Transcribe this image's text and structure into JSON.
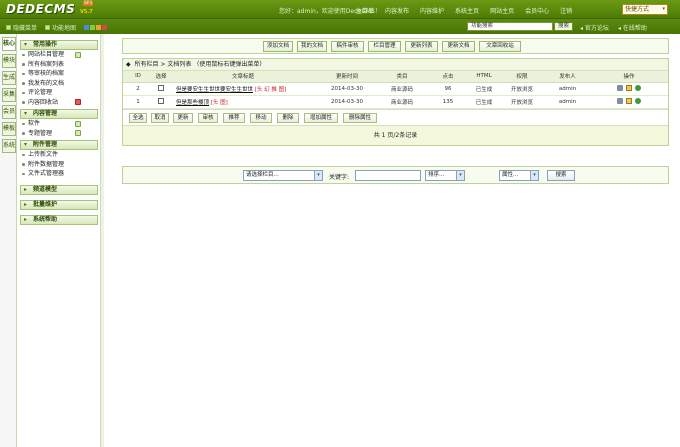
{
  "header": {
    "logo": "DEDECMS",
    "logo_badge": "SP1",
    "version": "V5.7",
    "welcome": "您好：admin，欢迎使用DedeCMS！",
    "nav": [
      "主菜单",
      "内容发布",
      "内容维护",
      "系统主页",
      "网站主页",
      "会员中心",
      "注销"
    ],
    "quick_menu": "快捷方式"
  },
  "subbar": {
    "hide_menu": "隐藏菜单",
    "sitemap": "功能地图",
    "skin_colors": [
      "#4a8fd3",
      "#8cc63f",
      "#f0a030",
      "#d04a4a"
    ],
    "search_placeholder": "功能搜索",
    "search_button": "搜索",
    "links": [
      "官方论坛",
      "在线帮助"
    ]
  },
  "vtabs": [
    "核心",
    "模块",
    "生成",
    "采集",
    "会员",
    "模板",
    "系统"
  ],
  "leftmenu": {
    "groups": [
      {
        "title": "常用操作",
        "items": [
          "网站栏目管理",
          "所有档案列表",
          "等审核的档案",
          "我发布的文档",
          "评论管理",
          "内容回收站"
        ]
      },
      {
        "title": "内容管理",
        "items": [
          "软件",
          "专题管理"
        ]
      },
      {
        "title": "附件管理",
        "items": [
          "上传新文件",
          "附件数据管理",
          "文件式管理器"
        ]
      },
      {
        "title": "频道模型",
        "items": []
      },
      {
        "title": "批量维护",
        "items": []
      },
      {
        "title": "系统帮助",
        "items": []
      }
    ]
  },
  "toolbar": [
    "添加文档",
    "我的文档",
    "稿件审核",
    "栏目管理",
    "更新列表",
    "更新文档",
    "文章回收站"
  ],
  "list": {
    "title": "所有栏目 > 文档列表",
    "hint": "（使用鼠标右键弹出菜单）",
    "columns": [
      "ID",
      "选择",
      "文章标题",
      "更新时间",
      "类目",
      "点击",
      "HTML",
      "权限",
      "发布人",
      "操作"
    ],
    "rows": [
      {
        "id": "2",
        "title": "但是要安生生世世要安生生世世",
        "tags": "[头 幻 推 图]",
        "date": "2014-03-30",
        "category": "商业源码",
        "clicks": "96",
        "html": "已生成",
        "perm": "开放浏览",
        "author": "admin"
      },
      {
        "id": "1",
        "title": "但是那些楼顶",
        "tags": "[头 图]",
        "date": "2014-03-30",
        "category": "商业源码",
        "clicks": "135",
        "html": "已生成",
        "perm": "开放浏览",
        "author": "admin"
      }
    ],
    "bulk_buttons": [
      "全选",
      "取消",
      "更新",
      "审核",
      "推荐",
      "移动",
      "删除",
      "增加属性",
      "删除属性"
    ],
    "pager": "共 1 页/2条记录"
  },
  "filter": {
    "column_select": "请选择栏目...",
    "keyword_label": "关键字:",
    "keyword_value": "",
    "sort_select": "排序...",
    "attr_select": "属性...",
    "search_button": "搜索"
  }
}
